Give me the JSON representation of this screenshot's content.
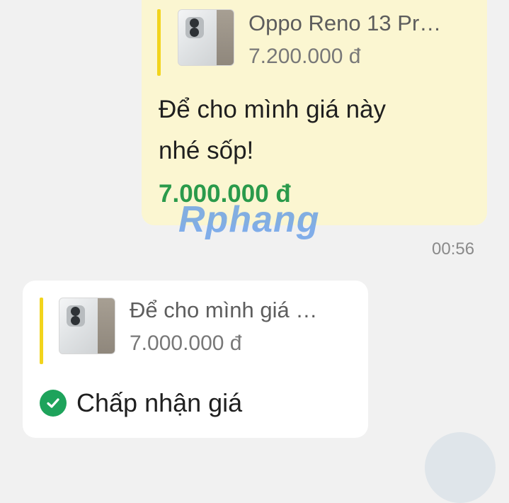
{
  "sent_message": {
    "quote": {
      "title": "Oppo Reno 13 Pr…",
      "price": "7.200.000 đ",
      "thumbnail_icon": "phone-product-image"
    },
    "text_line1": "Để cho mình giá này",
    "text_line2": "nhé sốp!",
    "offer_price": "7.000.000 đ",
    "time": "00:56"
  },
  "watermark": "Rphang",
  "received_message": {
    "quote": {
      "title": "Để cho mình giá …",
      "price": "7.000.000 đ",
      "thumbnail_icon": "phone-product-image"
    },
    "accept_label": "Chấp nhận giá",
    "accept_icon": "check-circle-icon"
  },
  "colors": {
    "sent_bubble": "#fbf6d1",
    "received_bubble": "#ffffff",
    "quote_bar": "#f2d41c",
    "offer_price": "#2a9a4b",
    "accept_check": "#1ea35b"
  }
}
